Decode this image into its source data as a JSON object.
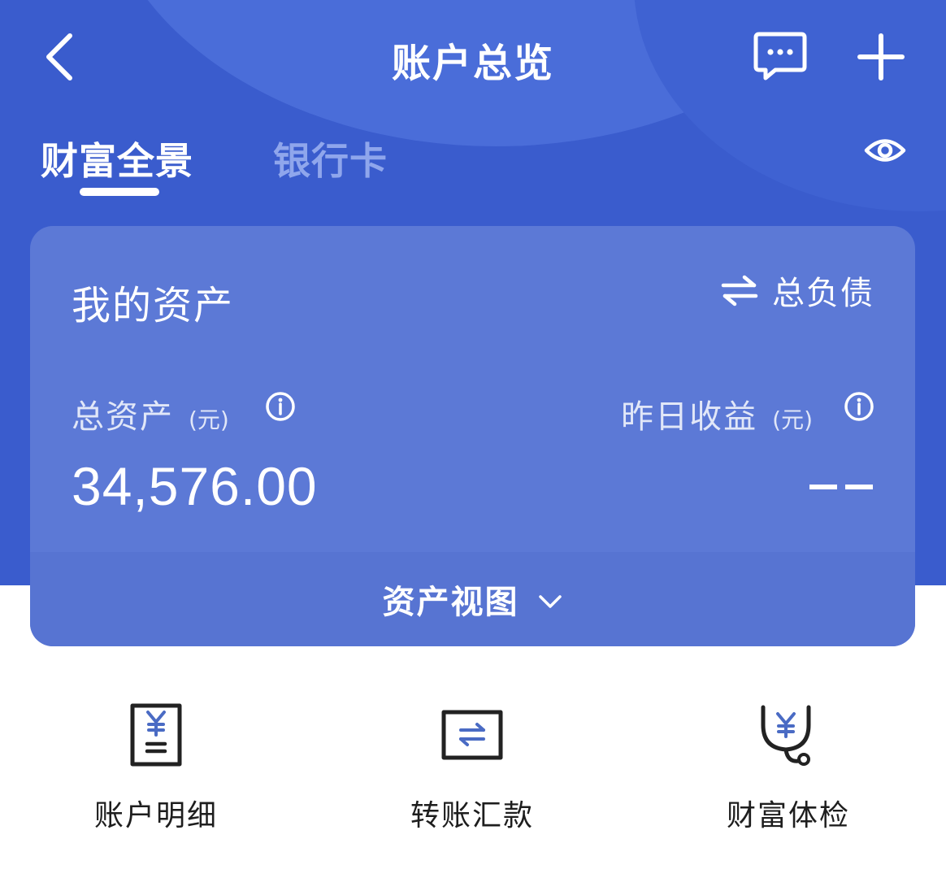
{
  "header": {
    "title": "账户总览",
    "back_icon": "chevron-left-icon",
    "message_icon": "message-icon",
    "add_icon": "plus-icon"
  },
  "tabs": [
    {
      "label": "财富全景",
      "active": true
    },
    {
      "label": "银行卡",
      "active": false
    }
  ],
  "visibility_icon": "eye-icon",
  "assets_card": {
    "title": "我的资产",
    "switch_label": "总负债",
    "total_assets": {
      "label": "总资产",
      "unit": "(元)",
      "value": "34,576.00"
    },
    "yesterday_income": {
      "label": "昨日收益",
      "unit": "(元)",
      "value": "--"
    },
    "view_toggle_label": "资产视图"
  },
  "quick_actions": [
    {
      "label": "账户明细",
      "icon": "receipt-yuan-icon"
    },
    {
      "label": "转账汇款",
      "icon": "transfer-icon"
    },
    {
      "label": "财富体检",
      "icon": "stethoscope-yuan-icon"
    }
  ],
  "colors": {
    "brand_blue": "#3a5ccd",
    "card_blue": "#5c79d6",
    "inactive_tab": "#8fa6ec",
    "icon_accent": "#4a6bc4"
  }
}
